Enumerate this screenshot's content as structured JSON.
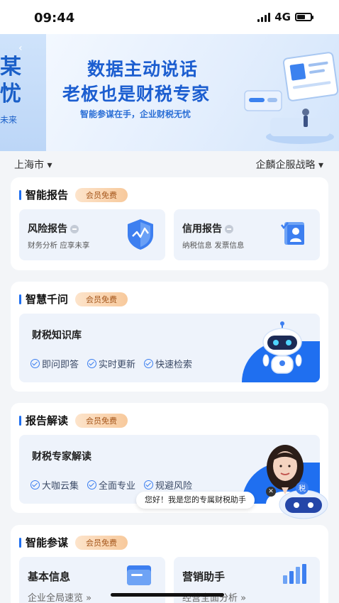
{
  "status_bar": {
    "time": "09:44",
    "network": "4G"
  },
  "banner": {
    "prev_big": "某\n忧",
    "prev_big_1": "某",
    "prev_big_2": "忧",
    "prev_small": "未来",
    "line1": "数据主动说话",
    "line2": "老板也是财税专家",
    "line3": "智能参谋在手，企业财税无忧"
  },
  "location_bar": {
    "city": "上海市 ▾",
    "strategy": "企麟企服战略 ▾"
  },
  "sections": {
    "report": {
      "title": "智能报告",
      "badge": "会员免费",
      "items": [
        {
          "title": "风险报告",
          "desc": "财务分析 应享未享"
        },
        {
          "title": "信用报告",
          "desc": "纳税信息 发票信息"
        }
      ]
    },
    "qa": {
      "title": "智慧千问",
      "badge": "会员免费",
      "feature_title": "财税知识库",
      "tags": [
        "即问即答",
        "实时更新",
        "快速检索"
      ]
    },
    "interpret": {
      "title": "报告解读",
      "badge": "会员免费",
      "feature_title": "财税专家解读",
      "tags": [
        "大咖云集",
        "全面专业",
        "规避风险"
      ]
    },
    "advisor": {
      "title": "智能参谋",
      "badge": "会员免费",
      "items": [
        {
          "title": "基本信息",
          "desc": "企业全局速览 »"
        },
        {
          "title": "营销助手",
          "desc": "经营全面分析 »"
        }
      ]
    }
  },
  "assistant": {
    "bubble": "您好！我是您的专属财税助手",
    "badge": "税"
  },
  "colors": {
    "accent": "#1f6ff0",
    "badge_text": "#a4551a",
    "card_bg": "#eef3fb"
  }
}
